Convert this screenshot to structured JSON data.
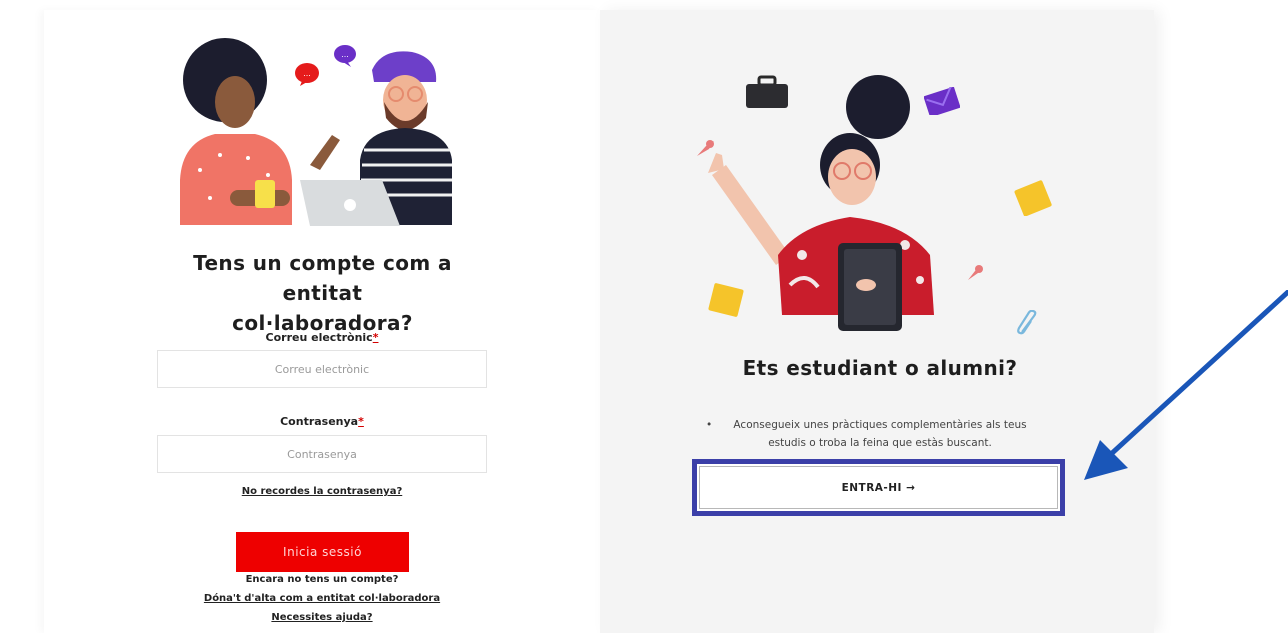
{
  "partner": {
    "heading_line1": "Tens un compte com a entitat",
    "heading_line2": "col·laboradora?",
    "email_label": "Correu electrònic",
    "email_placeholder": "Correu electrònic",
    "password_label": "Contrasenya",
    "password_placeholder": "Contrasenya",
    "required_mark": "*",
    "forgot_password": "No recordes la contrasenya?",
    "login_button": "Inicia sessió",
    "no_account": "Encara no tens un compte?",
    "register_link": "Dóna't d'alta com a entitat col·laboradora",
    "help_link": "Necessites ajuda?"
  },
  "student": {
    "heading": "Ets estudiant o alumni?",
    "bullet_line1": "Aconsegueix unes pràctiques complementàries als teus",
    "bullet_line2": "estudis o troba la feina que estàs buscant.",
    "bullet_marker": "•",
    "enter_button": "ENTRA-HI →"
  },
  "colors": {
    "login_red": "#ee0000",
    "highlight_frame": "#3b3fa8",
    "arrow_blue": "#1a56b8"
  },
  "icons": [
    "chat-bubble-icon",
    "suitcase-icon",
    "envelope-icon",
    "sticky-note-icon",
    "pushpin-icon",
    "paperclip-icon",
    "annotation-arrow"
  ]
}
